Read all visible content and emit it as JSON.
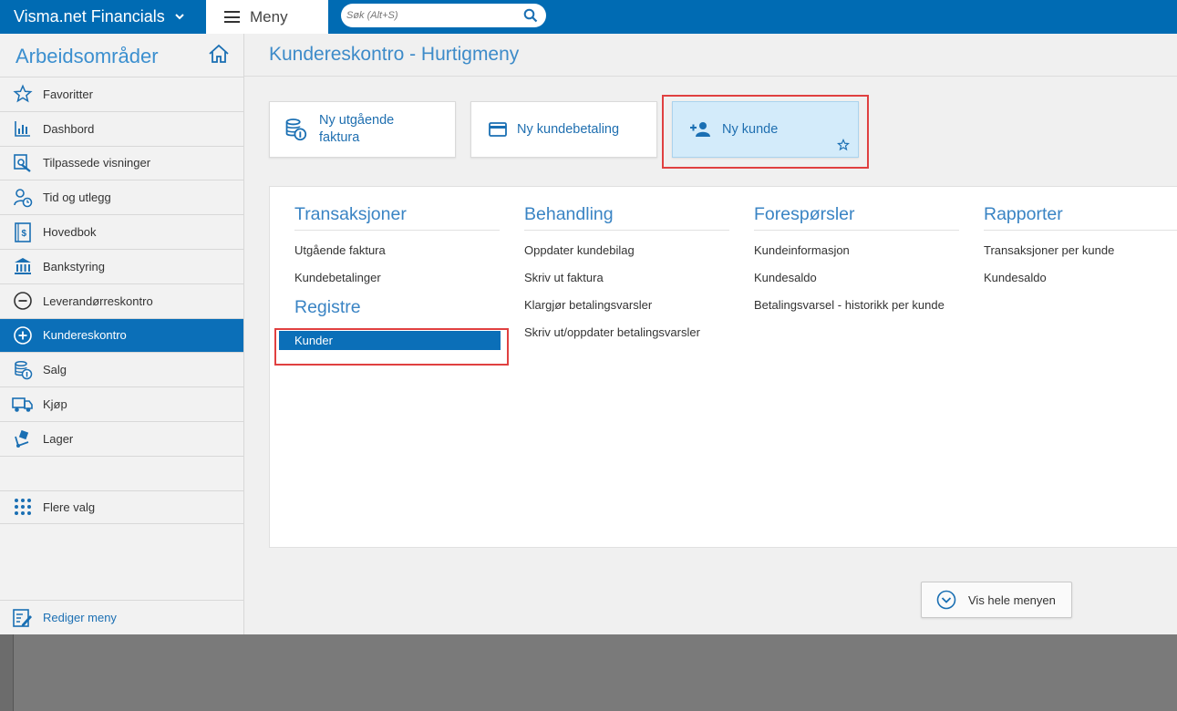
{
  "topbar": {
    "brand": "Visma.net Financials",
    "menu_label": "Meny",
    "search_placeholder": "Søk (Alt+S)"
  },
  "sidebar": {
    "title": "Arbeidsområder",
    "items": [
      {
        "label": "Favoritter",
        "icon": "star-icon"
      },
      {
        "label": "Dashbord",
        "icon": "bar-chart-icon"
      },
      {
        "label": "Tilpassede visninger",
        "icon": "custom-view-icon"
      },
      {
        "label": "Tid og utlegg",
        "icon": "person-clock-icon"
      },
      {
        "label": "Hovedbok",
        "icon": "ledger-icon"
      },
      {
        "label": "Bankstyring",
        "icon": "bank-icon"
      },
      {
        "label": "Leverandørreskontro",
        "icon": "minus-circle-icon"
      },
      {
        "label": "Kundereskontro",
        "icon": "plus-circle-icon",
        "active": true
      },
      {
        "label": "Salg",
        "icon": "coins-icon"
      },
      {
        "label": "Kjøp",
        "icon": "truck-icon"
      },
      {
        "label": "Lager",
        "icon": "hand-truck-icon"
      }
    ],
    "more": "Flere valg",
    "edit_menu": "Rediger meny"
  },
  "main": {
    "title": "Kundereskontro - Hurtigmeny",
    "tiles": [
      {
        "label_line1": "Ny utgående",
        "label_line2": "faktura"
      },
      {
        "label": "Ny kundebetaling"
      },
      {
        "label": "Ny kunde"
      }
    ],
    "columns": {
      "transaksjoner": {
        "heading": "Transaksjoner",
        "links": [
          "Utgående faktura",
          "Kundebetalinger"
        ]
      },
      "registre": {
        "heading": "Registre",
        "links": [
          "Kunder"
        ]
      },
      "behandling": {
        "heading": "Behandling",
        "links": [
          "Oppdater kundebilag",
          "Skriv ut faktura",
          "Klargjør betalingsvarsler",
          "Skriv ut/oppdater betalingsvarsler"
        ]
      },
      "foresporsler": {
        "heading": "Forespørsler",
        "links": [
          "Kundeinformasjon",
          "Kundesaldo",
          "Betalingsvarsel - historikk per kunde"
        ]
      },
      "rapporter": {
        "heading": "Rapporter",
        "links": [
          "Transaksjoner per kunde",
          "Kundesaldo"
        ]
      }
    },
    "show_full_menu": "Vis hele menyen"
  },
  "colors": {
    "brand_blue": "#006bb3",
    "active_blue": "#0b6fb8",
    "highlight_red": "#e04040",
    "tile_highlight": "#d3ebfa"
  }
}
